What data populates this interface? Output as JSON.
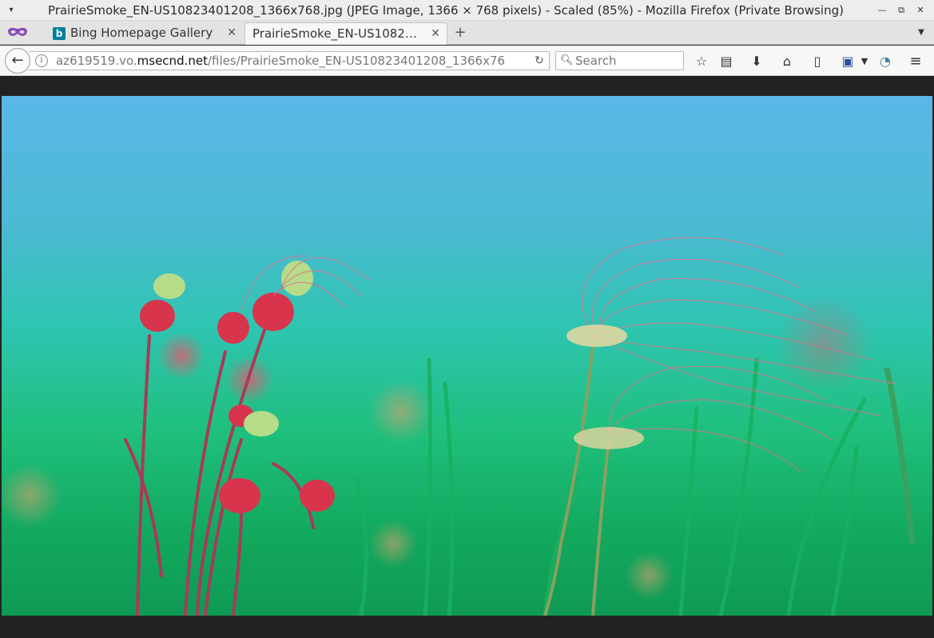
{
  "window": {
    "title": "PrairieSmoke_EN-US10823401208_1366x768.jpg (JPEG Image, 1366 × 768 pixels) - Scaled (85%) - Mozilla Firefox (Private Browsing)"
  },
  "tabs": [
    {
      "label": "Bing Homepage Gallery",
      "active": false
    },
    {
      "label": "PrairieSmoke_EN-US1082…",
      "active": true
    }
  ],
  "urlbar": {
    "prefix": "az619519.vo.",
    "host": "msecnd.net",
    "path": "/files/PrairieSmoke_EN-US10823401208_1366x76"
  },
  "search": {
    "placeholder": "Search"
  },
  "icons": {
    "private_browsing": "private-mask-icon",
    "bing_favicon": "b"
  },
  "colors": {
    "private_mask": "#8c4ab8",
    "bing_blue": "#00809d"
  }
}
